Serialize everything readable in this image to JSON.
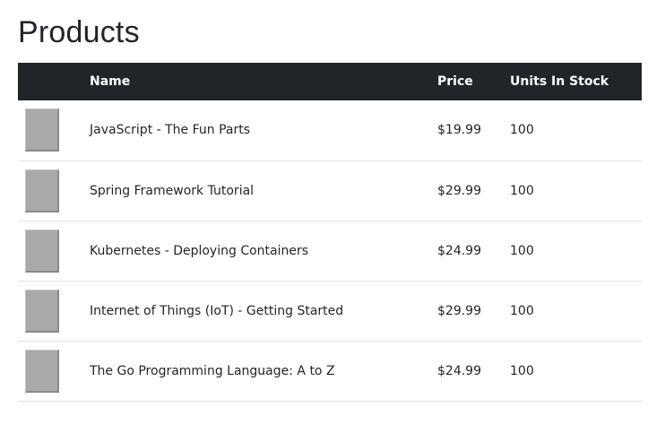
{
  "page": {
    "title": "Products"
  },
  "table": {
    "headers": {
      "image": "",
      "name": "Name",
      "price": "Price",
      "units": "Units In Stock"
    },
    "rows": [
      {
        "name": "JavaScript - The Fun Parts",
        "price": "$19.99",
        "units": "100"
      },
      {
        "name": "Spring Framework Tutorial",
        "price": "$29.99",
        "units": "100"
      },
      {
        "name": "Kubernetes - Deploying Containers",
        "price": "$24.99",
        "units": "100"
      },
      {
        "name": "Internet of Things (IoT) - Getting Started",
        "price": "$29.99",
        "units": "100"
      },
      {
        "name": "The Go Programming Language: A to Z",
        "price": "$24.99",
        "units": "100"
      }
    ]
  },
  "colors": {
    "header_bg": "#212529",
    "header_text": "#ffffff",
    "row_divider": "#dee2e6",
    "thumbnail_placeholder": "#a9a9a9"
  }
}
